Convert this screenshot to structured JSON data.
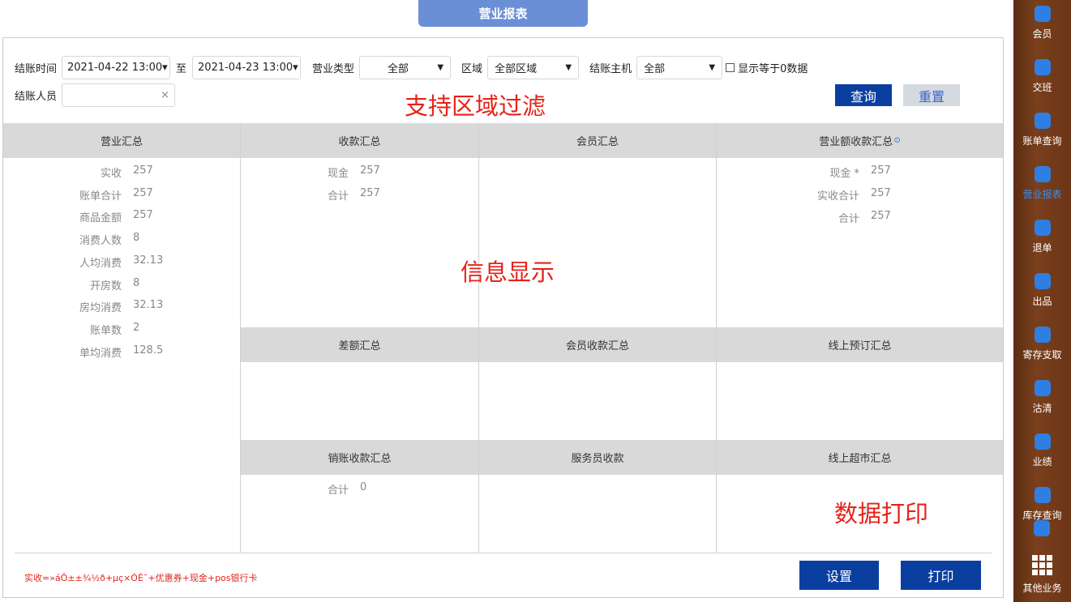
{
  "header": {
    "title": "营业报表"
  },
  "filters": {
    "checkout_time_label": "结账时间",
    "start_time": "2021-04-22 13:00▾",
    "to_label": "至",
    "end_time": "2021-04-23 13:00▾",
    "business_type_label": "营业类型",
    "business_type_value": "全部",
    "area_label": "区域",
    "area_value": "全部区域",
    "host_label": "结账主机",
    "host_value": "全部",
    "show_zero_label": "显示等于0数据",
    "cashier_label": "结账人员",
    "cashier_value": "",
    "clear_icon": "×",
    "query_button": "查询",
    "reset_button": "重置"
  },
  "annotations": {
    "area_filter": "支持区域过滤",
    "info_display": "信息显示",
    "data_print": "数据打印"
  },
  "sections": {
    "business_summary": {
      "title": "营业汇总",
      "rows": [
        {
          "k": "实收",
          "v": "257"
        },
        {
          "k": "账单合计",
          "v": "257"
        },
        {
          "k": "商品金额",
          "v": "257"
        },
        {
          "k": "消费人数",
          "v": "8"
        },
        {
          "k": "人均消费",
          "v": "32.13"
        },
        {
          "k": "开房数",
          "v": "8"
        },
        {
          "k": "房均消费",
          "v": "32.13"
        },
        {
          "k": "账单数",
          "v": "2"
        },
        {
          "k": "单均消费",
          "v": "128.5"
        }
      ]
    },
    "payment_summary": {
      "title": "收款汇总",
      "rows": [
        {
          "k": "现金",
          "v": "257"
        },
        {
          "k": "合计",
          "v": "257"
        }
      ]
    },
    "member_summary": {
      "title": "会员汇总"
    },
    "revenue_payment_summary": {
      "title": "营业额收款汇总",
      "help_icon": "⊙",
      "rows": [
        {
          "k": "现金 *",
          "v": "257"
        },
        {
          "k": "实收合计",
          "v": "257"
        },
        {
          "k": "合计",
          "v": "257"
        }
      ]
    },
    "difference_summary": {
      "title": "差额汇总"
    },
    "member_payment_summary": {
      "title": "会员收款汇总"
    },
    "online_booking_summary": {
      "title": "线上预订汇总"
    },
    "writeoff_summary": {
      "title": "销账收款汇总",
      "rows": [
        {
          "k": "合计",
          "v": "0"
        }
      ]
    },
    "waiter_payment": {
      "title": "服务员收款"
    },
    "online_market_summary": {
      "title": "线上超市汇总"
    }
  },
  "footer": {
    "formula": "实收=»áÔ±±¾½ð+µç×ÓÈ¯+优惠券+现金+pos银行卡",
    "settings_button": "设置",
    "print_button": "打印"
  },
  "sidebar": {
    "items": [
      {
        "label": "会员",
        "icon": "member-icon"
      },
      {
        "label": "交班",
        "icon": "shift-icon"
      },
      {
        "label": "账单查询",
        "icon": "bill-query-icon"
      },
      {
        "label": "营业报表",
        "icon": "report-icon"
      },
      {
        "label": "退单",
        "icon": "refund-icon"
      },
      {
        "label": "出品",
        "icon": "output-icon"
      },
      {
        "label": "寄存支取",
        "icon": "deposit-icon"
      },
      {
        "label": "沽清",
        "icon": "soldout-icon"
      },
      {
        "label": "业绩",
        "icon": "performance-icon"
      },
      {
        "label": "库存查询",
        "icon": "inventory-icon"
      },
      {
        "label": "其他业务",
        "icon": "grid-icon"
      }
    ]
  },
  "colors": {
    "accent": "#0a3fa0",
    "title_tab": "#6b8fd6",
    "annotation": "#e4231a",
    "sidebar": "#6b3517",
    "active": "#3d8ef0"
  }
}
